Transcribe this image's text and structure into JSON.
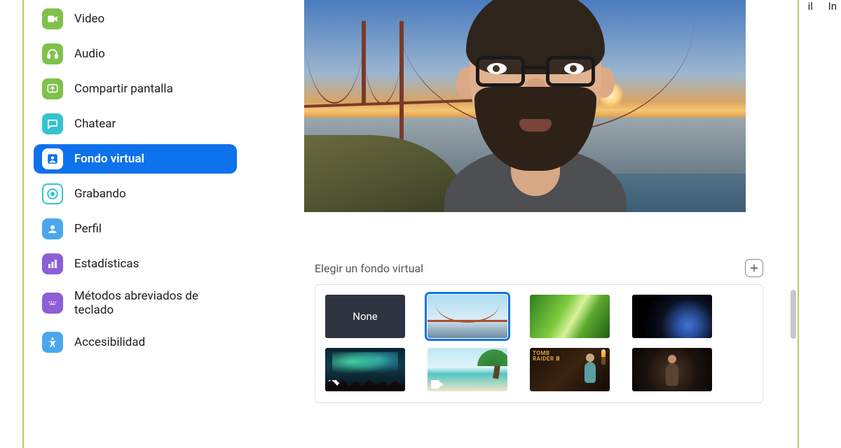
{
  "toplinks": {
    "a": "il",
    "b": "In"
  },
  "sidebar": {
    "items": [
      {
        "label": "Video",
        "color": "#7fc24b",
        "icon": "video"
      },
      {
        "label": "Audio",
        "color": "#7fc24b",
        "icon": "audio"
      },
      {
        "label": "Compartir pantalla",
        "color": "#7fc24b",
        "icon": "share"
      },
      {
        "label": "Chatear",
        "color": "#33c3d0",
        "icon": "chat"
      },
      {
        "label": "Fondo virtual",
        "color": "#ffffff",
        "icon": "portrait",
        "active": true
      },
      {
        "label": "Grabando",
        "color": "#33c3d0",
        "icon": "record"
      },
      {
        "label": "Perfil",
        "color": "#4aa7ee",
        "icon": "profile"
      },
      {
        "label": "Estadísticas",
        "color": "#8e5ed6",
        "icon": "stats"
      },
      {
        "label": "Métodos abreviados de teclado",
        "color": "#8e5ed6",
        "icon": "keyboard"
      },
      {
        "label": "Accesibilidad",
        "color": "#4aa7ee",
        "icon": "access"
      }
    ]
  },
  "section_title": "Elegir un fondo virtual",
  "backgrounds": {
    "row1": [
      {
        "name": "none",
        "label": "None",
        "selected": false
      },
      {
        "name": "bridge",
        "selected": true
      },
      {
        "name": "grass",
        "selected": false
      },
      {
        "name": "earth",
        "selected": false
      }
    ],
    "row2": [
      {
        "name": "aurora",
        "video": true
      },
      {
        "name": "beach",
        "video": true
      },
      {
        "name": "tr3",
        "logo": "TOMB\nRAIDER III"
      },
      {
        "name": "dark"
      }
    ]
  },
  "colors": {
    "accent": "#0e72ed"
  }
}
